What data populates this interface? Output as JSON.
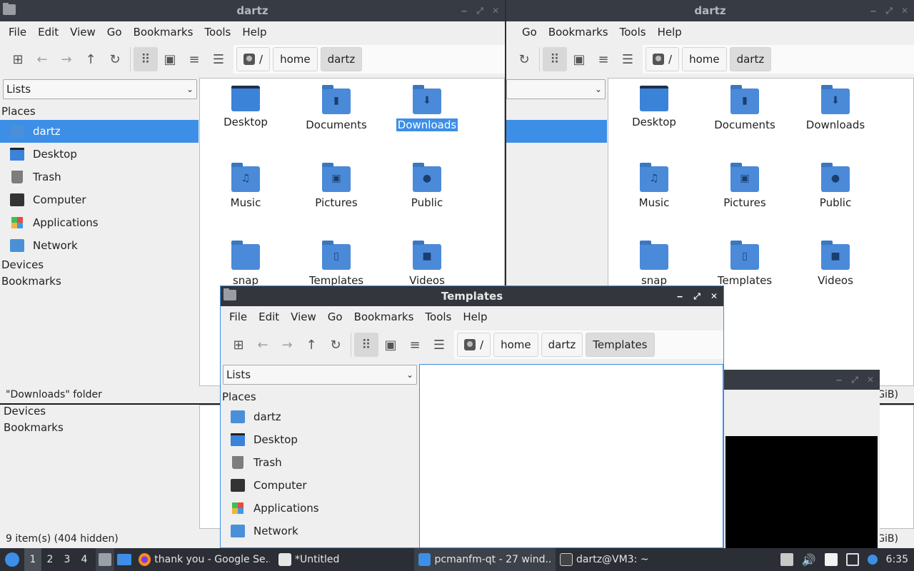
{
  "menu": [
    "File",
    "Edit",
    "View",
    "Go",
    "Bookmarks",
    "Tools",
    "Help"
  ],
  "menu_right": [
    "Go",
    "Bookmarks",
    "Tools",
    "Help"
  ],
  "window_left": {
    "title": "dartz",
    "view_mode": "Lists",
    "status": "\"Downloads\" folder"
  },
  "window_right": {
    "title": "dartz",
    "status_tail": "GiB)"
  },
  "crumbs": [
    "/",
    "home",
    "dartz"
  ],
  "templates_window": {
    "title": "Templates",
    "crumbs": [
      "/",
      "home",
      "dartz",
      "Templates"
    ],
    "view_mode": "Lists"
  },
  "sidebar": {
    "places_label": "Places",
    "devices_label": "Devices",
    "bookmarks_label": "Bookmarks",
    "items": [
      "dartz",
      "Desktop",
      "Trash",
      "Computer",
      "Applications",
      "Network"
    ]
  },
  "files": [
    {
      "name": "Desktop",
      "icon": "desktop-folder-icon"
    },
    {
      "name": "Documents",
      "icon": "documents-folder-icon"
    },
    {
      "name": "Downloads",
      "icon": "downloads-folder-icon"
    },
    {
      "name": "Music",
      "icon": "music-folder-icon"
    },
    {
      "name": "Pictures",
      "icon": "pictures-folder-icon"
    },
    {
      "name": "Public",
      "icon": "public-folder-icon"
    },
    {
      "name": "snap",
      "icon": "folder-icon"
    },
    {
      "name": "Templates",
      "icon": "templates-folder-icon"
    },
    {
      "name": "Videos",
      "icon": "videos-folder-icon"
    }
  ],
  "bottom_window": {
    "devices_label": "Devices",
    "bookmarks_label": "Bookmarks",
    "status": "9 item(s) (404 hidden)",
    "status_tail": "GiB)"
  },
  "taskbar": {
    "desktops": [
      "1",
      "2",
      "3",
      "4"
    ],
    "tasks": [
      "thank you - Google Se...",
      "*Untitled",
      "pcmanfm-qt - 27 wind...",
      "dartz@VM3: ~"
    ],
    "clock": "6:35"
  }
}
